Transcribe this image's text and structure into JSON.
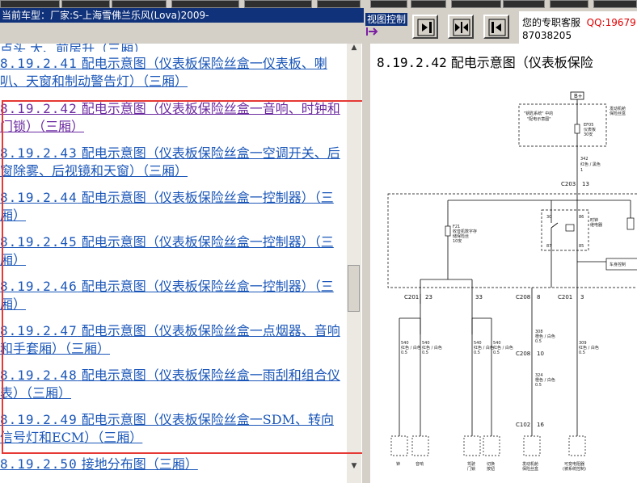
{
  "header": {
    "car_model": "当前车型：厂家:S-上海雪佛兰乐风(Lova)2009-",
    "view_control_label": "视图控制",
    "support_label": "您的专职客服",
    "support_qq": "QQ:19679",
    "support_phone": "87038205"
  },
  "toc": {
    "partial_top": "点头 大、前房升（三厢）",
    "items": [
      {
        "num": "8.19.2.41",
        "title": "配电示意图（仪表板保险丝盒一仪表板、喇叭、天窗和制动警告灯）（三厢）"
      },
      {
        "num": "8.19.2.42",
        "title": "配电示意图（仪表板保险丝盒一音响、时钟和门锁）（三厢）"
      },
      {
        "num": "8.19.2.43",
        "title": "配电示意图（仪表板保险丝盒一空调开关、后窗除雾、后视镜和天窗）（三厢）"
      },
      {
        "num": "8.19.2.44",
        "title": "配电示意图（仪表板保险丝盒一控制器）（三厢）"
      },
      {
        "num": "8.19.2.45",
        "title": "配电示意图（仪表板保险丝盒一控制器）（三厢）"
      },
      {
        "num": "8.19.2.46",
        "title": "配电示意图（仪表板保险丝盒一控制器）（三厢）"
      },
      {
        "num": "8.19.2.47",
        "title": "配电示意图（仪表板保险丝盒一点烟器、音响和手套厢）（三厢）"
      },
      {
        "num": "8.19.2.48",
        "title": "配电示意图（仪表板保险丝盒一雨刮和组合仪表）（三厢）"
      },
      {
        "num": "8.19.2.49",
        "title": "配电示意图（仪表板保险丝盒一SDM、转向信号灯和ECM）（三厢）"
      },
      {
        "num": "8.19.2.50",
        "title": "接地分布图（三厢）"
      }
    ]
  },
  "diagram": {
    "title_num": "8.19.2.42",
    "title_text": "配电示意图（仪表板保险",
    "labels": {
      "bplus": "B+",
      "top_box_1": "\"钥匙系统\" 中的",
      "top_box_2": "\"配电示意图\"",
      "right_top_1": "发动机舱",
      "right_top_2": "保险丝盒",
      "fuse_top_1": "EF05",
      "fuse_top_2": "仪表板",
      "fuse_top_3": "30安",
      "wire_342": "342",
      "wire_342_color": "红色 / 黑色",
      "wire_342_size": "1",
      "c203": "C203",
      "c203_pin": "13",
      "f21_1": "F21",
      "f21_2": "收音机数字存",
      "f21_3": "储保险丝",
      "f21_4": "10安",
      "relay_1": "时钟",
      "relay_2": "继电器",
      "pin_30": "30",
      "pin_86": "86",
      "pin_87": "87",
      "pin_85": "85",
      "ctrl_box": "车身控制",
      "c201_left": "C201",
      "c201_left_pin": "23",
      "c201_mid_pin": "33",
      "c208": "C208",
      "c208_pin": "8",
      "c201_right": "C201",
      "c201_right_pin": "3",
      "w540": "540",
      "w540_color": "红色 / 白色",
      "w540_size": "0.5",
      "w308": "308",
      "w308_color": "橙色 / 白色",
      "w308_size": "0.5",
      "w309": "309",
      "w309_color": "红色 / 白色",
      "w309_size": "0.5",
      "c208_lower": "C208",
      "c208_lower_pin": "10",
      "w324": "324",
      "w324_color": "橙色 / 白色",
      "w324_size": "0.5",
      "c102": "C102",
      "c102_pin": "16",
      "comp_clock": "钟",
      "comp_audio": "音响",
      "comp_door_1": "驾驶",
      "comp_door_2": "门锁",
      "comp_switch_1": "切换",
      "comp_switch_2": "按钮",
      "comp_engine_1": "发动机舱",
      "comp_engine_2": "保险丝盒",
      "comp_right_1": "可变电阻器",
      "comp_right_2": "(被系统控制)"
    }
  },
  "colors": {
    "link": "#1a56b8",
    "visited": "#6b2aa0",
    "highlight_frame": "#e53935",
    "header_bg": "#10327a"
  }
}
